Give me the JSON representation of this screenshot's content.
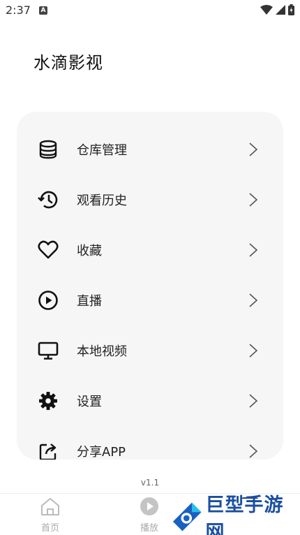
{
  "status_bar": {
    "time": "2:37",
    "notification_badge": "A"
  },
  "page": {
    "title": "水滴影视"
  },
  "menu": {
    "items": [
      {
        "label": "仓库管理",
        "icon": "database-icon"
      },
      {
        "label": "观看历史",
        "icon": "history-icon"
      },
      {
        "label": "收藏",
        "icon": "heart-icon"
      },
      {
        "label": "直播",
        "icon": "play-circle-icon"
      },
      {
        "label": "本地视频",
        "icon": "monitor-icon"
      },
      {
        "label": "设置",
        "icon": "gear-icon"
      },
      {
        "label": "分享APP",
        "icon": "share-icon"
      }
    ]
  },
  "version": "v1.1",
  "bottom_nav": {
    "home_label": "首页",
    "play_label": "播放"
  },
  "watermark": {
    "text": "巨型手游网"
  },
  "colors": {
    "card_bg": "#f6f6f6",
    "watermark_blue": "#1a4fa0",
    "nav_inactive": "#aaaaaa"
  }
}
